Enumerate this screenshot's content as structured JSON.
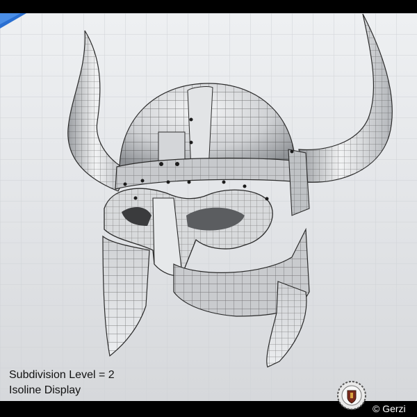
{
  "viewport": {
    "overlay_line_1": "Subdivision Level = 2",
    "overlay_line_2": "Isoline Display",
    "background_color": "#e6e8eb",
    "grid_color": "#cfd2d6",
    "accent_tab_color": "#2a6fd1"
  },
  "model": {
    "surface_color": "#dadcde",
    "shadow_color": "#8f9296",
    "wire_color": "#2a2a2a"
  },
  "footer": {
    "copyright": "© Gerzi",
    "badge_icon": "gear-crest-logo-icon"
  }
}
